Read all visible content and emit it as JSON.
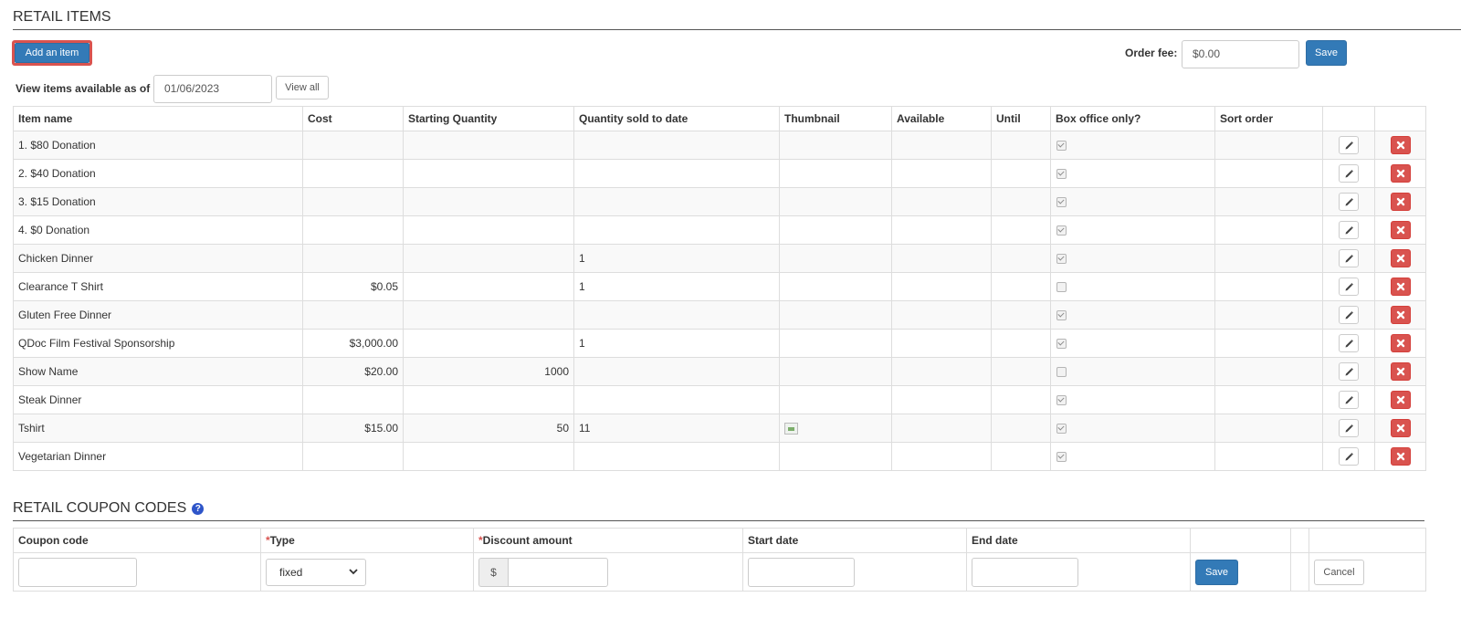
{
  "retail_items": {
    "title": "RETAIL ITEMS",
    "add_button": "Add an item",
    "order_fee_label": "Order fee:",
    "order_fee_value": "$0.00",
    "save_button": "Save",
    "view_label": "View items available as of",
    "view_date": "01/06/2023",
    "view_all_button": "View all",
    "columns": [
      "Item name",
      "Cost",
      "Starting Quantity",
      "Quantity sold to date",
      "Thumbnail",
      "Available",
      "Until",
      "Box office only?",
      "Sort order",
      "",
      ""
    ],
    "rows": [
      {
        "name": "1. $80 Donation",
        "cost": "",
        "starting_qty": "",
        "sold": "",
        "thumbnail": false,
        "available": "",
        "until": "",
        "box_office_only": true,
        "sort_order": ""
      },
      {
        "name": "2. $40 Donation",
        "cost": "",
        "starting_qty": "",
        "sold": "",
        "thumbnail": false,
        "available": "",
        "until": "",
        "box_office_only": true,
        "sort_order": ""
      },
      {
        "name": "3. $15 Donation",
        "cost": "",
        "starting_qty": "",
        "sold": "",
        "thumbnail": false,
        "available": "",
        "until": "",
        "box_office_only": true,
        "sort_order": ""
      },
      {
        "name": "4. $0 Donation",
        "cost": "",
        "starting_qty": "",
        "sold": "",
        "thumbnail": false,
        "available": "",
        "until": "",
        "box_office_only": true,
        "sort_order": ""
      },
      {
        "name": "Chicken Dinner",
        "cost": "",
        "starting_qty": "",
        "sold": "1",
        "thumbnail": false,
        "available": "",
        "until": "",
        "box_office_only": true,
        "sort_order": ""
      },
      {
        "name": "Clearance T Shirt",
        "cost": "$0.05",
        "starting_qty": "",
        "sold": "1",
        "thumbnail": false,
        "available": "",
        "until": "",
        "box_office_only": false,
        "sort_order": ""
      },
      {
        "name": "Gluten Free Dinner",
        "cost": "",
        "starting_qty": "",
        "sold": "",
        "thumbnail": false,
        "available": "",
        "until": "",
        "box_office_only": true,
        "sort_order": ""
      },
      {
        "name": "QDoc Film Festival Sponsorship",
        "cost": "$3,000.00",
        "starting_qty": "",
        "sold": "1",
        "thumbnail": false,
        "available": "",
        "until": "",
        "box_office_only": true,
        "sort_order": ""
      },
      {
        "name": "Show Name",
        "cost": "$20.00",
        "starting_qty": "1000",
        "sold": "",
        "thumbnail": false,
        "available": "",
        "until": "",
        "box_office_only": false,
        "sort_order": ""
      },
      {
        "name": "Steak Dinner",
        "cost": "",
        "starting_qty": "",
        "sold": "",
        "thumbnail": false,
        "available": "",
        "until": "",
        "box_office_only": true,
        "sort_order": ""
      },
      {
        "name": "Tshirt",
        "cost": "$15.00",
        "starting_qty": "50",
        "sold": "11",
        "thumbnail": true,
        "available": "",
        "until": "",
        "box_office_only": true,
        "sort_order": ""
      },
      {
        "name": "Vegetarian Dinner",
        "cost": "",
        "starting_qty": "",
        "sold": "",
        "thumbnail": false,
        "available": "",
        "until": "",
        "box_office_only": true,
        "sort_order": ""
      }
    ]
  },
  "coupons": {
    "title": "RETAIL COUPON CODES",
    "help_icon": "?",
    "columns": {
      "code": "Coupon code",
      "type_required": "*",
      "type": "Type",
      "discount_required": "*",
      "discount": "Discount amount",
      "start": "Start date",
      "end": "End date"
    },
    "type_value": "fixed",
    "currency_symbol": "$",
    "save_button": "Save",
    "cancel_button": "Cancel"
  },
  "icons": {
    "edit": "pencil-icon",
    "delete": "x-icon",
    "checkbox": "checkbox-icon",
    "thumbnail": "broken-image-icon",
    "select_caret": "chevron-down-icon",
    "help": "question-circle-icon"
  },
  "colors": {
    "primary": "#337ab7",
    "danger": "#d9534f",
    "highlight": "#d9534f"
  }
}
